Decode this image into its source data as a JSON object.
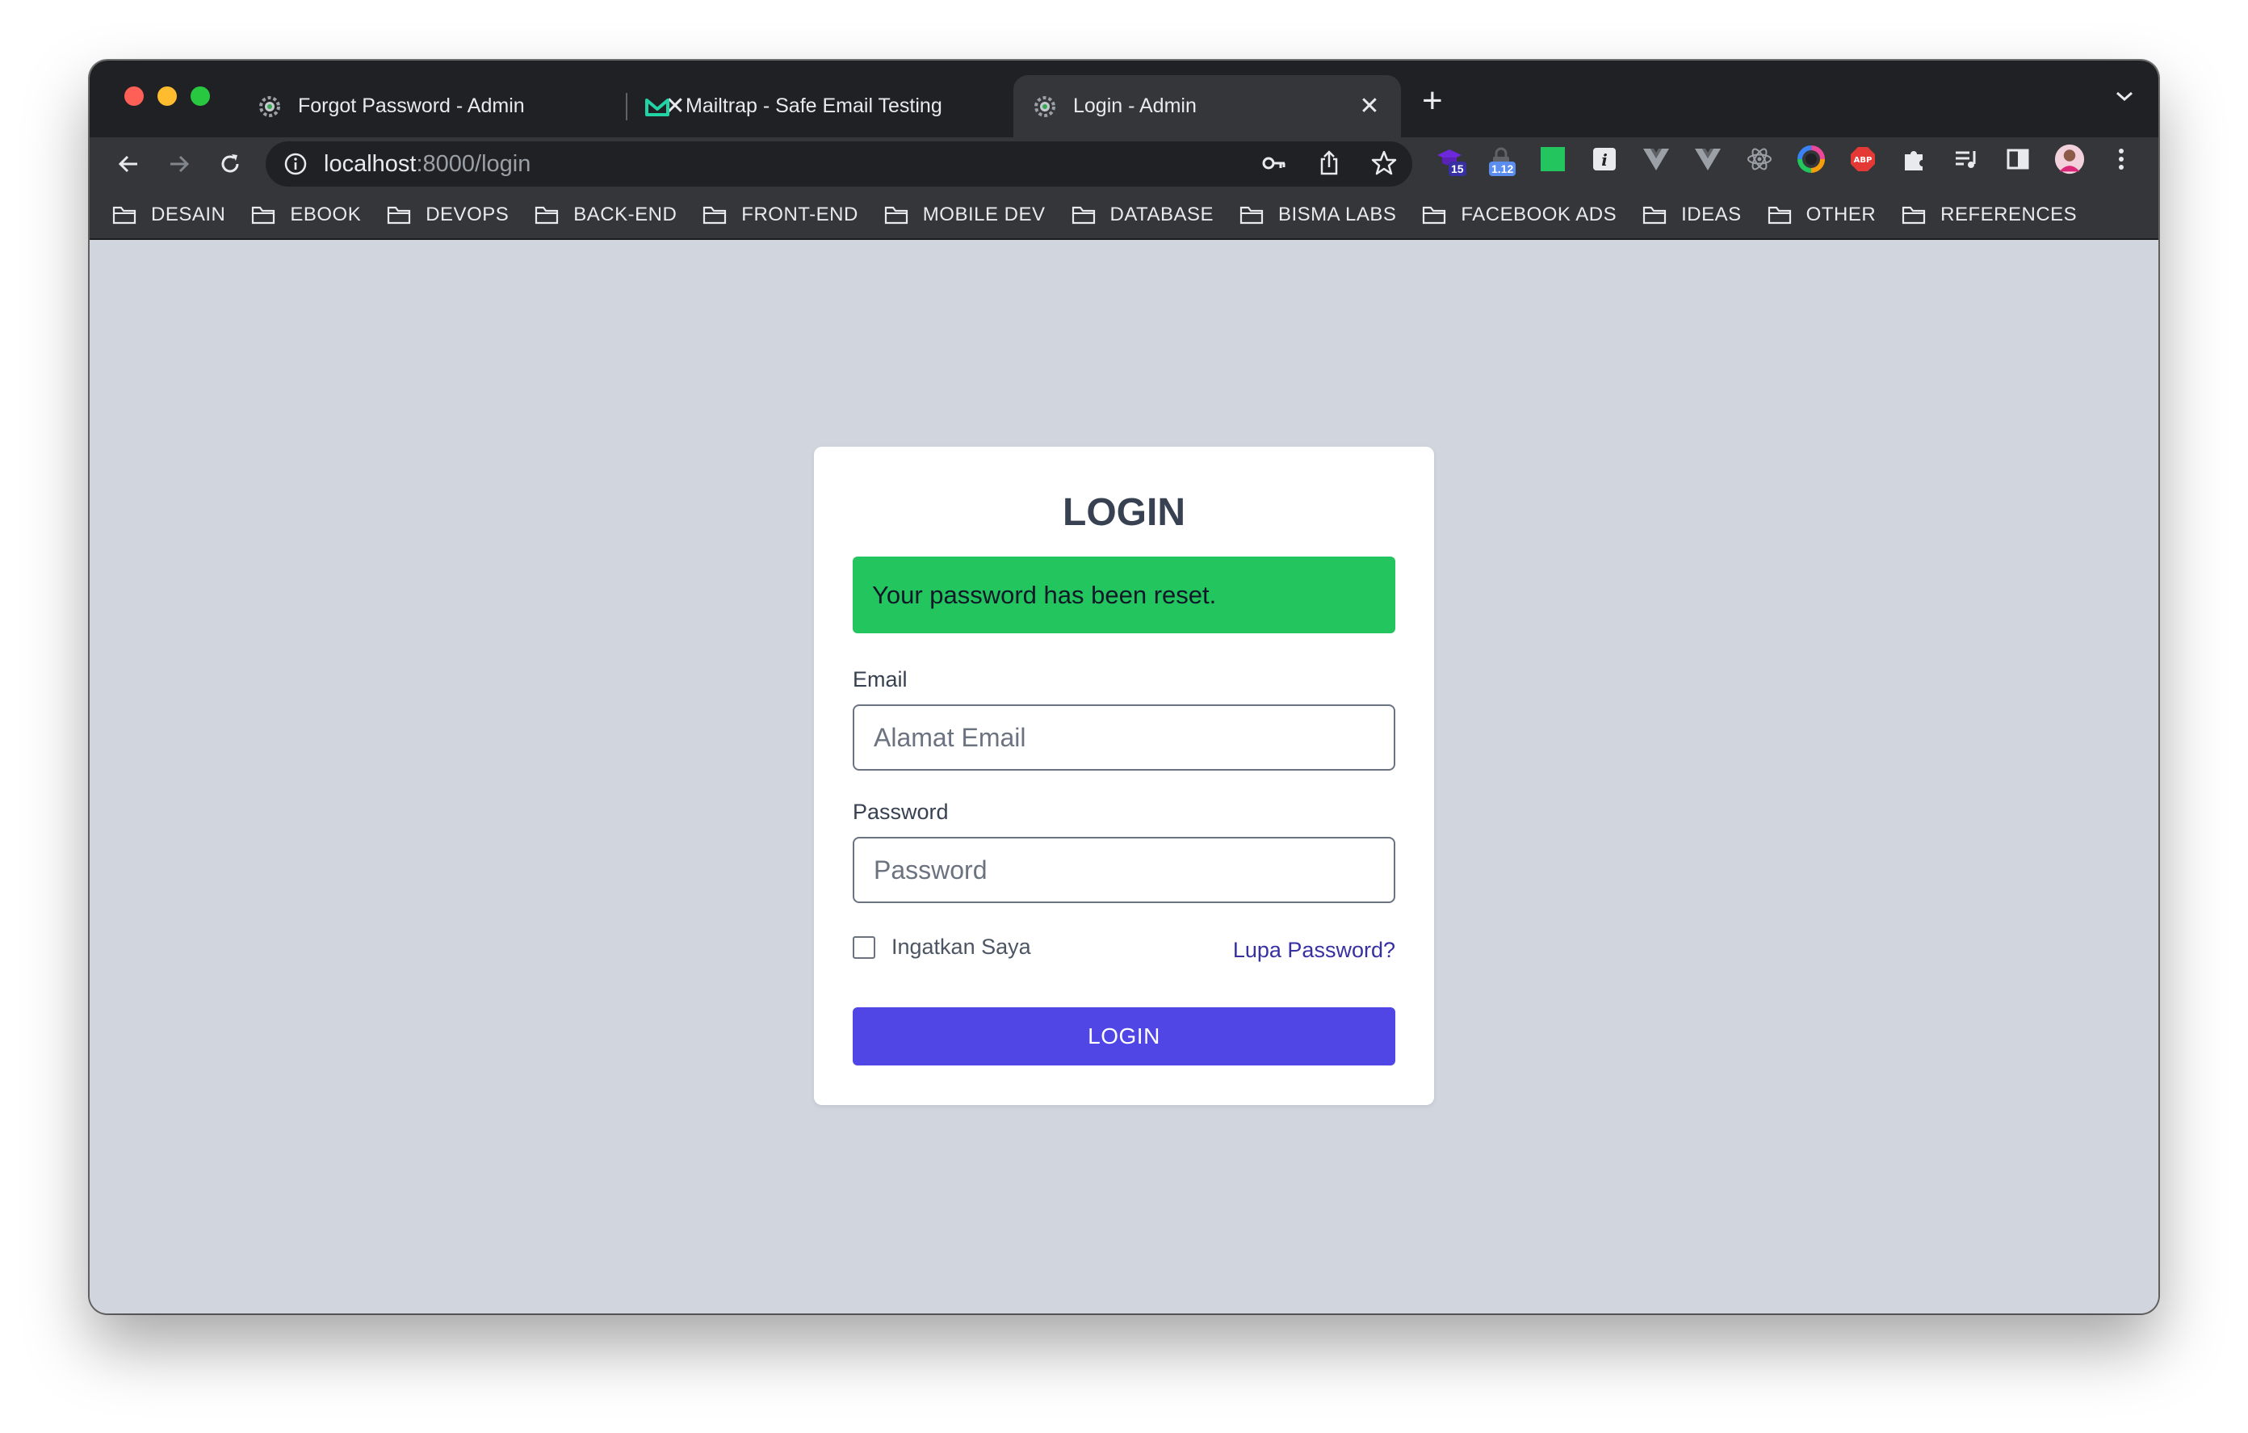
{
  "browser": {
    "tabs": [
      {
        "title": "Forgot Password - Admin",
        "icon": "gear-favicon",
        "active": false
      },
      {
        "title": "Mailtrap - Safe Email Testing",
        "icon": "mailtrap-favicon",
        "active": false
      },
      {
        "title": "Login - Admin",
        "icon": "gear-favicon",
        "active": true
      }
    ],
    "url": {
      "host": "localhost",
      "path": ":8000/login"
    },
    "extensions": {
      "badge_a": "15",
      "badge_b": "1.12"
    },
    "bookmarks": [
      "DESAIN",
      "EBOOK",
      "DEVOPS",
      "BACK-END",
      "FRONT-END",
      "MOBILE DEV",
      "DATABASE",
      "BISMA LABS",
      "FACEBOOK ADS",
      "IDEAS",
      "OTHER",
      "REFERENCES"
    ]
  },
  "login": {
    "title": "LOGIN",
    "alert": "Your password has been reset.",
    "email_label": "Email",
    "email_placeholder": "Alamat Email",
    "password_label": "Password",
    "password_placeholder": "Password",
    "remember_label": "Ingatkan Saya",
    "forgot_link": "Lupa Password?",
    "submit_label": "LOGIN"
  },
  "colors": {
    "page_bg": "#d1d5de",
    "alert_bg": "#22c55e",
    "primary": "#4f46e5",
    "link": "#3730a3"
  }
}
